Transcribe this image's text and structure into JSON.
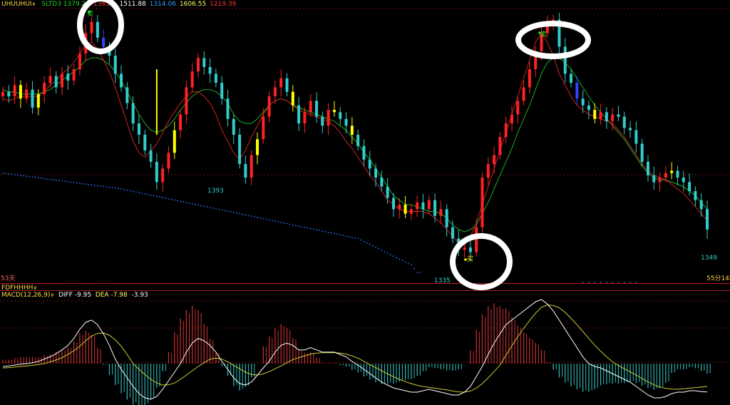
{
  "top_bar": {
    "name": "UHUUHUI",
    "items": [
      {
        "label": "SLTD3",
        "value": "1379.20",
        "color": "#22cc22"
      },
      {
        "label": "",
        "value": "1365.4",
        "color": "#ff3333"
      },
      {
        "label": "",
        "value": "1511.88",
        "color": "#ffffff"
      },
      {
        "label": "",
        "value": "1314.06",
        "color": "#3399ff"
      },
      {
        "label": "",
        "value": "1606.55",
        "color": "#ffff66"
      },
      {
        "label": "",
        "value": "1219.39",
        "color": "#ff3333"
      }
    ]
  },
  "main_panel": {
    "left_footer": "53天",
    "right_footer": "55分14秒",
    "price_labels": [
      "1393",
      "1335",
      "1349"
    ],
    "signals": [
      "卖",
      "买",
      "卖"
    ]
  },
  "indicator_bar": {
    "name": "FDFHHHH",
    "macd_title": "MACD(12,26,9)",
    "diff_label": "DIFF",
    "diff_value": "-9.95",
    "dea_label": "DEA",
    "dea_value": "-7.98",
    "macd_value": "-3.93"
  },
  "colors": {
    "up": "#ff2222",
    "down": "#33cccc",
    "highlight": "#ffff00",
    "ma_green": "#22aa22",
    "ma_red": "#cc2222",
    "dotted": "#2277ee",
    "diff_line": "#ffffff",
    "dea_line": "#cccc33",
    "bg": "#000000"
  },
  "chart_data": [
    {
      "type": "candlestick",
      "title": "",
      "x_count": 120,
      "ylim": [
        1330,
        1445
      ],
      "close": [
        1410,
        1408,
        1413,
        1407,
        1411,
        1403,
        1409,
        1414,
        1417,
        1412,
        1418,
        1415,
        1420,
        1427,
        1436,
        1441,
        1434,
        1430,
        1426,
        1418,
        1412,
        1405,
        1396,
        1391,
        1384,
        1379,
        1370,
        1376,
        1383,
        1393,
        1400,
        1412,
        1419,
        1425,
        1421,
        1418,
        1414,
        1407,
        1398,
        1391,
        1378,
        1372,
        1382,
        1389,
        1399,
        1408,
        1412,
        1416,
        1410,
        1404,
        1396,
        1401,
        1406,
        1399,
        1395,
        1402,
        1401,
        1398,
        1395,
        1391,
        1386,
        1380,
        1376,
        1372,
        1368,
        1363,
        1358,
        1360,
        1356,
        1358,
        1361,
        1358,
        1362,
        1355,
        1358,
        1350,
        1345,
        1340,
        1341,
        1339,
        1350,
        1372,
        1378,
        1382,
        1390,
        1396,
        1400,
        1406,
        1412,
        1420,
        1428,
        1436,
        1440,
        1442,
        1430,
        1418,
        1414,
        1407,
        1404,
        1402,
        1398,
        1401,
        1397,
        1400,
        1399,
        1394,
        1393,
        1387,
        1379,
        1373,
        1370,
        1372,
        1374,
        1375,
        1372,
        1370,
        1366,
        1362,
        1358,
        1349
      ],
      "ma_green": [
        1411,
        1410,
        1410,
        1409,
        1409,
        1409,
        1409,
        1410,
        1411,
        1413,
        1415,
        1417,
        1419,
        1421,
        1424,
        1425,
        1425,
        1424,
        1422,
        1419,
        1415,
        1410,
        1405,
        1400,
        1396,
        1393,
        1392,
        1393,
        1395,
        1398,
        1402,
        1405,
        1408,
        1410,
        1411,
        1411,
        1410,
        1408,
        1405,
        1400,
        1397,
        1396,
        1396,
        1398,
        1401,
        1404,
        1406,
        1407,
        1406,
        1404,
        1403,
        1402,
        1401,
        1400,
        1399,
        1398,
        1397,
        1395,
        1393,
        1390,
        1387,
        1383,
        1380,
        1376,
        1372,
        1368,
        1364,
        1362,
        1360,
        1360,
        1359,
        1358,
        1357,
        1357,
        1356,
        1354,
        1351,
        1349,
        1348,
        1349,
        1351,
        1356,
        1361,
        1367,
        1373,
        1379,
        1385,
        1392,
        1398,
        1404,
        1411,
        1418,
        1423,
        1425,
        1425,
        1423,
        1420,
        1416,
        1412,
        1408,
        1404,
        1401,
        1398,
        1395,
        1392,
        1389,
        1385,
        1381,
        1377,
        1374,
        1372,
        1371,
        1371,
        1370,
        1369,
        1368,
        1366,
        1364,
        1361,
        1358
      ],
      "ma_red": [
        1407,
        1406,
        1407,
        1408,
        1408,
        1408,
        1408,
        1410,
        1413,
        1415,
        1418,
        1420,
        1423,
        1427,
        1431,
        1432,
        1429,
        1424,
        1419,
        1412,
        1404,
        1396,
        1388,
        1383,
        1381,
        1384,
        1387,
        1392,
        1397,
        1401,
        1405,
        1408,
        1410,
        1410,
        1408,
        1405,
        1400,
        1393,
        1388,
        1383,
        1380,
        1384,
        1390,
        1395,
        1400,
        1404,
        1406,
        1407,
        1406,
        1404,
        1402,
        1401,
        1400,
        1399,
        1398,
        1397,
        1395,
        1392,
        1388,
        1385,
        1381,
        1377,
        1373,
        1370,
        1366,
        1362,
        1360,
        1358,
        1357,
        1357,
        1357,
        1357,
        1356,
        1354,
        1352,
        1349,
        1346,
        1343,
        1342,
        1346,
        1352,
        1360,
        1368,
        1376,
        1384,
        1392,
        1400,
        1408,
        1416,
        1424,
        1432,
        1436,
        1432,
        1426,
        1418,
        1413,
        1408,
        1404,
        1402,
        1400,
        1399,
        1398,
        1397,
        1396,
        1393,
        1390,
        1386,
        1382,
        1378,
        1375,
        1373,
        1372,
        1371,
        1369,
        1367,
        1365,
        1362,
        1359,
        1356,
        1353
      ],
      "price_labels": [
        {
          "x": 29,
          "value": 1393
        },
        {
          "x": 62,
          "value": 1335
        },
        {
          "x": 119,
          "value": 1349
        }
      ]
    },
    {
      "type": "macd",
      "title": "MACD(12,26,9)",
      "ylim": [
        -14,
        14
      ],
      "series": [
        {
          "name": "DIFF",
          "values": [
            -1,
            -0.8,
            -0.5,
            -0.2,
            0,
            0.2,
            0.5,
            1,
            1.5,
            2.2,
            3,
            4,
            5.5,
            7.5,
            9,
            9.5,
            8.5,
            6.5,
            4,
            1,
            -2,
            -5,
            -8,
            -10.5,
            -12,
            -12.5,
            -11.5,
            -9,
            -6,
            -3,
            0,
            2.5,
            4.5,
            5.5,
            5,
            4,
            2.5,
            0.5,
            -2,
            -5,
            -7,
            -7.5,
            -6.5,
            -4,
            -1.5,
            0.5,
            2.5,
            4,
            4.5,
            4,
            3,
            3,
            3.5,
            3,
            2.5,
            2.5,
            2.5,
            2,
            1.5,
            0.5,
            -0.5,
            -2,
            -3.5,
            -5,
            -6.5,
            -7.5,
            -8.5,
            -9,
            -9.5,
            -10,
            -10,
            -9.5,
            -9,
            -9.5,
            -10,
            -10.5,
            -11,
            -11,
            -10,
            -8,
            -4.5,
            -1,
            2,
            4.5,
            6.5,
            8.5,
            9.5,
            10.5,
            11.5,
            12.5,
            13.5,
            14,
            13,
            11.5,
            9.5,
            7.5,
            5.5,
            3.5,
            1.5,
            0,
            -1,
            -1.5,
            -2.5,
            -3.5,
            -4.5,
            -5.5,
            -6.5,
            -8,
            -9.5,
            -11,
            -12,
            -12,
            -11.5,
            -10.5,
            -10,
            -10,
            -9.5,
            -9.5,
            -9.8,
            -9.95
          ]
        },
        {
          "name": "DEA",
          "values": [
            -1.5,
            -1.4,
            -1.2,
            -1,
            -0.8,
            -0.6,
            -0.3,
            0,
            0.4,
            0.8,
            1.3,
            2,
            2.8,
            3.8,
            5,
            6,
            6.6,
            6.7,
            6.2,
            5.2,
            3.8,
            2,
            0,
            -2,
            -3.8,
            -5.5,
            -6.8,
            -7.5,
            -7.4,
            -6.8,
            -5.5,
            -4,
            -2.5,
            -1,
            0.2,
            1,
            1.2,
            1,
            0.4,
            -0.6,
            -1.8,
            -3,
            -3.8,
            -4,
            -3.6,
            -2.8,
            -1.8,
            -0.8,
            0.2,
            0.9,
            1.3,
            1.7,
            2.1,
            2.3,
            2.4,
            2.4,
            2.4,
            2.3,
            2.1,
            1.7,
            1.2,
            0.5,
            -0.4,
            -1.4,
            -2.5,
            -3.6,
            -4.6,
            -5.5,
            -6.3,
            -7,
            -7.6,
            -8,
            -8.3,
            -8.6,
            -8.9,
            -9.2,
            -9.6,
            -9.9,
            -10,
            -9.6,
            -8.6,
            -7,
            -5,
            -2.8,
            -0.5,
            1.8,
            3.9,
            5.9,
            7.7,
            9.4,
            11,
            12.3,
            12.8,
            12.7,
            12.2,
            11.2,
            9.9,
            8.5,
            7,
            5.5,
            4,
            2.7,
            1.5,
            0.4,
            -0.7,
            -1.8,
            -2.9,
            -4,
            -5.2,
            -6.4,
            -7.4,
            -8.2,
            -8.7,
            -8.9,
            -9,
            -8.8,
            -8.6,
            -8.4,
            -8.2,
            -7.98
          ]
        },
        {
          "name": "MACD",
          "values": [
            1,
            0.9,
            1.4,
            1.6,
            1.6,
            1.6,
            1.6,
            2,
            2.2,
            2.8,
            3.4,
            4,
            5.4,
            7.4,
            8,
            7,
            3.8,
            -0.4,
            -4.4,
            -8.4,
            -11.6,
            -14,
            -16,
            -17,
            -16.4,
            -14,
            -9.4,
            -3,
            2.8,
            7.6,
            11,
            13,
            14,
            13,
            9.6,
            6,
            2.6,
            -1,
            -4.8,
            -8.8,
            -10.4,
            -9,
            -5.4,
            0,
            4.2,
            6.6,
            8.6,
            9.6,
            8.6,
            6.2,
            3.4,
            2.6,
            2.8,
            1.4,
            0.2,
            0.2,
            0.2,
            -0.6,
            -1.2,
            -2.4,
            -3.4,
            -5,
            -6.2,
            -7.2,
            -8,
            -7.8,
            -7.8,
            -7,
            -6.4,
            -6,
            -4.8,
            -3,
            -1.4,
            -1.8,
            -2.2,
            -2.6,
            -2.8,
            -2.2,
            0,
            3.2,
            8.2,
            12,
            14,
            14.6,
            14,
            13.4,
            11.2,
            9.2,
            7.6,
            6.2,
            5,
            3.4,
            0.4,
            -2.4,
            -5.4,
            -7.4,
            -8.8,
            -10,
            -11,
            -11,
            -10,
            -8.4,
            -8,
            -7.8,
            -7.8,
            -7.6,
            -7.2,
            -7.6,
            -8.6,
            -9.6,
            -10.2,
            -9.6,
            -7.4,
            -3.6,
            -2.2,
            -2.2,
            -1.4,
            -1.8,
            -2.8,
            -3.93
          ]
        }
      ]
    }
  ]
}
